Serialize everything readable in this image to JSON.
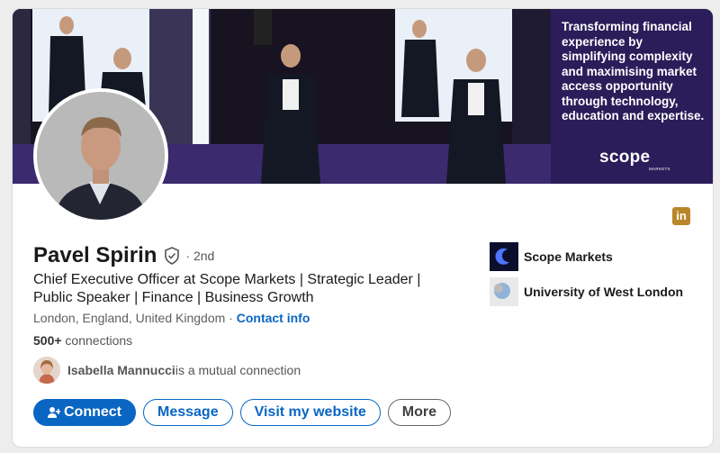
{
  "banner": {
    "tagline": "Transforming financial experience by simplifying complexity and maximising market access opportunity through technology, education and expertise.",
    "logo_text": "scope",
    "logo_sub": "MARKETS"
  },
  "profile": {
    "name": "Pavel Spirin",
    "degree": "· 2nd",
    "headline": "Chief Executive Officer at Scope Markets | Strategic Leader | Public Speaker | Finance | Business Growth",
    "location": "London, England, United Kingdom",
    "location_sep": " · ",
    "contact_label": "Contact info",
    "connections_count": "500+",
    "connections_label": " connections",
    "mutual_name": "Isabella Mannucci",
    "mutual_suffix": " is a mutual connection"
  },
  "actions": {
    "connect": "Connect",
    "message": "Message",
    "website": "Visit my website",
    "more": "More"
  },
  "organizations": [
    {
      "name": "Scope Markets"
    },
    {
      "name": "University of West London"
    }
  ],
  "linkedin_badge": "in",
  "colors": {
    "primary": "#0a66c2",
    "banner_panel": "#2a1d5a",
    "linkedin_badge": "#b9862a"
  }
}
